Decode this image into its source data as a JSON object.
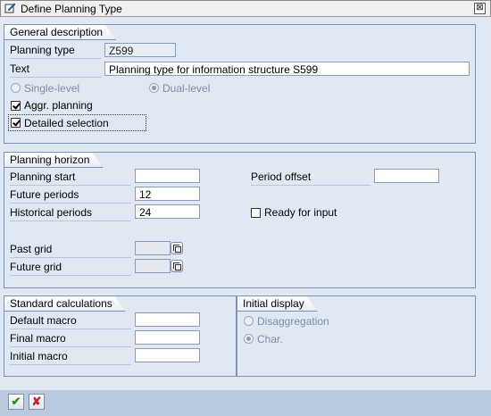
{
  "window": {
    "title": "Define Planning Type",
    "close_glyph": "⊠"
  },
  "general": {
    "heading": "General description",
    "planning_type_label": "Planning type",
    "planning_type_value": "Z599",
    "text_label": "Text",
    "text_value": "Planning type for information structure S599",
    "single_level": "Single-level",
    "dual_level": "Dual-level",
    "aggr_planning": "Aggr. planning",
    "detailed_selection": "Detailed selection"
  },
  "horizon": {
    "heading": "Planning horizon",
    "planning_start_label": "Planning start",
    "planning_start_value": "",
    "future_periods_label": "Future periods",
    "future_periods_value": "12",
    "historical_periods_label": "Historical periods",
    "historical_periods_value": "24",
    "period_offset_label": "Period offset",
    "period_offset_value": "",
    "ready_for_input": "Ready for input",
    "past_grid_label": "Past grid",
    "future_grid_label": "Future grid"
  },
  "calculations": {
    "heading": "Standard calculations",
    "default_macro_label": "Default macro",
    "final_macro_label": "Final macro",
    "initial_macro_label": "Initial macro"
  },
  "initial_display": {
    "heading": "Initial display",
    "disaggregation": "Disaggregation",
    "char": "Char."
  },
  "footer": {
    "ok_glyph": "✔",
    "cancel_glyph": "✘"
  },
  "colors": {
    "confirm": "#2f8a1f",
    "cancel": "#c8202a",
    "panel": "#dfe8f3",
    "frame": "#7e93b0"
  }
}
